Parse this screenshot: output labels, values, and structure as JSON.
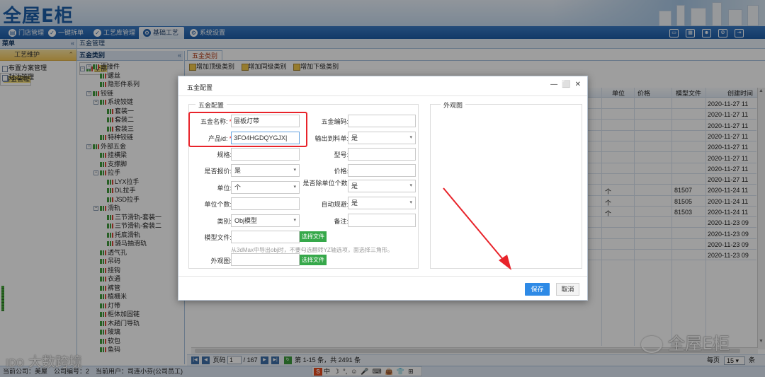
{
  "app": {
    "logo": "全屋E柜"
  },
  "nav": {
    "tabs": [
      {
        "label": "门店管理",
        "icon": "store-icon"
      },
      {
        "label": "一键拆单",
        "icon": "check-icon"
      },
      {
        "label": "工艺库管理",
        "icon": "check-icon"
      },
      {
        "label": "基础工艺",
        "icon": "gear-icon",
        "active": true
      },
      {
        "label": "系统设置",
        "icon": "settings-icon"
      }
    ],
    "right_icons": [
      "monitor-icon",
      "grid-icon",
      "user-icon",
      "gear-icon",
      "exit-icon"
    ]
  },
  "menu": {
    "header": "菜单",
    "section": "工艺维护",
    "items": [
      "布置方案管理",
      "五金管理",
      "封边管理"
    ],
    "selected": "五金管理"
  },
  "breadcrumb": "五金管理",
  "tree": {
    "header": "五金类别",
    "nodes": [
      {
        "label": "全部",
        "level": 0,
        "toggle": "⊟",
        "sel": true
      },
      {
        "label": "连接件",
        "level": 1,
        "toggle": "⊟"
      },
      {
        "label": "螺丝",
        "level": 2
      },
      {
        "label": "隐形件系列",
        "level": 2
      },
      {
        "label": "铰链",
        "level": 1,
        "toggle": "⊟"
      },
      {
        "label": "系统铰链",
        "level": 2,
        "toggle": "⊟"
      },
      {
        "label": "套装一",
        "level": 3
      },
      {
        "label": "套装二",
        "level": 3
      },
      {
        "label": "套装三",
        "level": 3
      },
      {
        "label": "特种铰链",
        "level": 2
      },
      {
        "label": "外部五金",
        "level": 1,
        "toggle": "⊟"
      },
      {
        "label": "挂横梁",
        "level": 2
      },
      {
        "label": "支撑脚",
        "level": 2
      },
      {
        "label": "拉手",
        "level": 2,
        "toggle": "⊟"
      },
      {
        "label": "LYX拉手",
        "level": 3
      },
      {
        "label": "DL拉手",
        "level": 3
      },
      {
        "label": "JSD拉手",
        "level": 3
      },
      {
        "label": "滑轨",
        "level": 2,
        "toggle": "⊟"
      },
      {
        "label": "三节滑轨-套装一",
        "level": 3
      },
      {
        "label": "三节滑轨-套装二",
        "level": 3
      },
      {
        "label": "托底滑轨",
        "level": 3
      },
      {
        "label": "骑马抽滑轨",
        "level": 3
      },
      {
        "label": "透气孔",
        "level": 2
      },
      {
        "label": "吊码",
        "level": 2
      },
      {
        "label": "挂钩",
        "level": 2
      },
      {
        "label": "衣通",
        "level": 2
      },
      {
        "label": "裤管",
        "level": 2
      },
      {
        "label": "植栅米",
        "level": 2
      },
      {
        "label": "灯带",
        "level": 2
      },
      {
        "label": "柜体加固链",
        "level": 2
      },
      {
        "label": "木趟门导轨",
        "level": 2
      },
      {
        "label": "玻璃",
        "level": 2
      },
      {
        "label": "软包",
        "level": 2
      },
      {
        "label": "鱼码",
        "level": 2
      }
    ]
  },
  "content": {
    "tab": "五金类别",
    "toolbar": [
      "增加顶级类别",
      "增加同级类别",
      "增加下级类别"
    ],
    "grid": {
      "columns": [
        "单位",
        "价格",
        "模型文件",
        "创建时间"
      ],
      "rows": [
        {
          "unit": "",
          "model": "",
          "date": "2020-11-27 11"
        },
        {
          "unit": "",
          "model": "",
          "date": "2020-11-27 11"
        },
        {
          "unit": "",
          "model": "",
          "date": "2020-11-27 11"
        },
        {
          "unit": "",
          "model": "",
          "date": "2020-11-27 11"
        },
        {
          "unit": "",
          "model": "",
          "date": "2020-11-27 11"
        },
        {
          "unit": "",
          "model": "",
          "date": "2020-11-27 11"
        },
        {
          "unit": "",
          "model": "",
          "date": "2020-11-27 11"
        },
        {
          "unit": "",
          "model": "",
          "date": "2020-11-27 11"
        },
        {
          "unit": "个",
          "model": "81507",
          "date": "2020-11-24 11"
        },
        {
          "unit": "个",
          "model": "81505",
          "date": "2020-11-24 11"
        },
        {
          "unit": "个",
          "model": "81503",
          "date": "2020-11-24 11"
        },
        {
          "unit": "",
          "model": "",
          "date": "2020-11-23 09"
        },
        {
          "unit": "",
          "model": "",
          "date": "2020-11-23 09"
        },
        {
          "unit": "",
          "model": "",
          "date": "2020-11-23 09"
        },
        {
          "unit": "",
          "model": "",
          "date": "2020-11-23 09"
        }
      ]
    },
    "pager": {
      "page_label": "页码",
      "page": "1",
      "total_pages": "/ 167",
      "summary": "第 1-15 条，共 2491 条",
      "per_page_label": "每页",
      "per_page": "15",
      "per_page_suffix": "条"
    }
  },
  "dialog": {
    "title": "五金配置",
    "section_main": "五金配置",
    "section_side": "外观图",
    "fields": {
      "name_label": "五金名称:",
      "name_value": "层板灯带",
      "code_label": "五金编码:",
      "code_value": "",
      "pid_label": "产品id:",
      "pid_value": "3FO4HGDQYGJX|",
      "output_label": "输出到料单:",
      "output_value": "是",
      "spec_label": "规格:",
      "spec_value": "",
      "model_label": "型号:",
      "model_value": "",
      "quote_label": "是否报价:",
      "quote_value": "是",
      "price_label": "价格:",
      "price_value": "",
      "unit_label": "单位:",
      "unit_value": "个",
      "divide_label": "是否除单位个数:",
      "divide_value": "是",
      "unitcount_label": "单位个数:",
      "unitcount_value": "",
      "autoplan_label": "自动规避:",
      "autoplan_value": "是",
      "type_label": "类别:",
      "type_value": "Obj模型",
      "remark_label": "备注:",
      "remark_value": "",
      "modelfile_label": "模型文件:",
      "modelfile_value": "",
      "choose_file": "选择文件",
      "hint": "从3dMax中导出obj时，不要勾选翻转YZ轴选项，面选择三角形。",
      "appearance_label": "外观图:",
      "appearance_value": "",
      "choose_file2": "选择文件"
    },
    "save": "保存",
    "cancel": "取消"
  },
  "status": {
    "text": "当前公司：美屋　公司编号：2　当前用户：司连小芬(公司员工)"
  },
  "ime": {
    "logo": "S",
    "items": [
      "中",
      "☽",
      "°,",
      "☺",
      "🎤",
      "⌨",
      "👜",
      "👕",
      "⊞"
    ]
  },
  "watermarks": {
    "left": "大数跨境",
    "left_logo": "IDO",
    "right": "全屋E柜"
  },
  "colors": {
    "nav": "#1f5ea8",
    "accent": "#2e8ae6",
    "highlight": "#e8232a",
    "file_btn": "#36a84a"
  }
}
